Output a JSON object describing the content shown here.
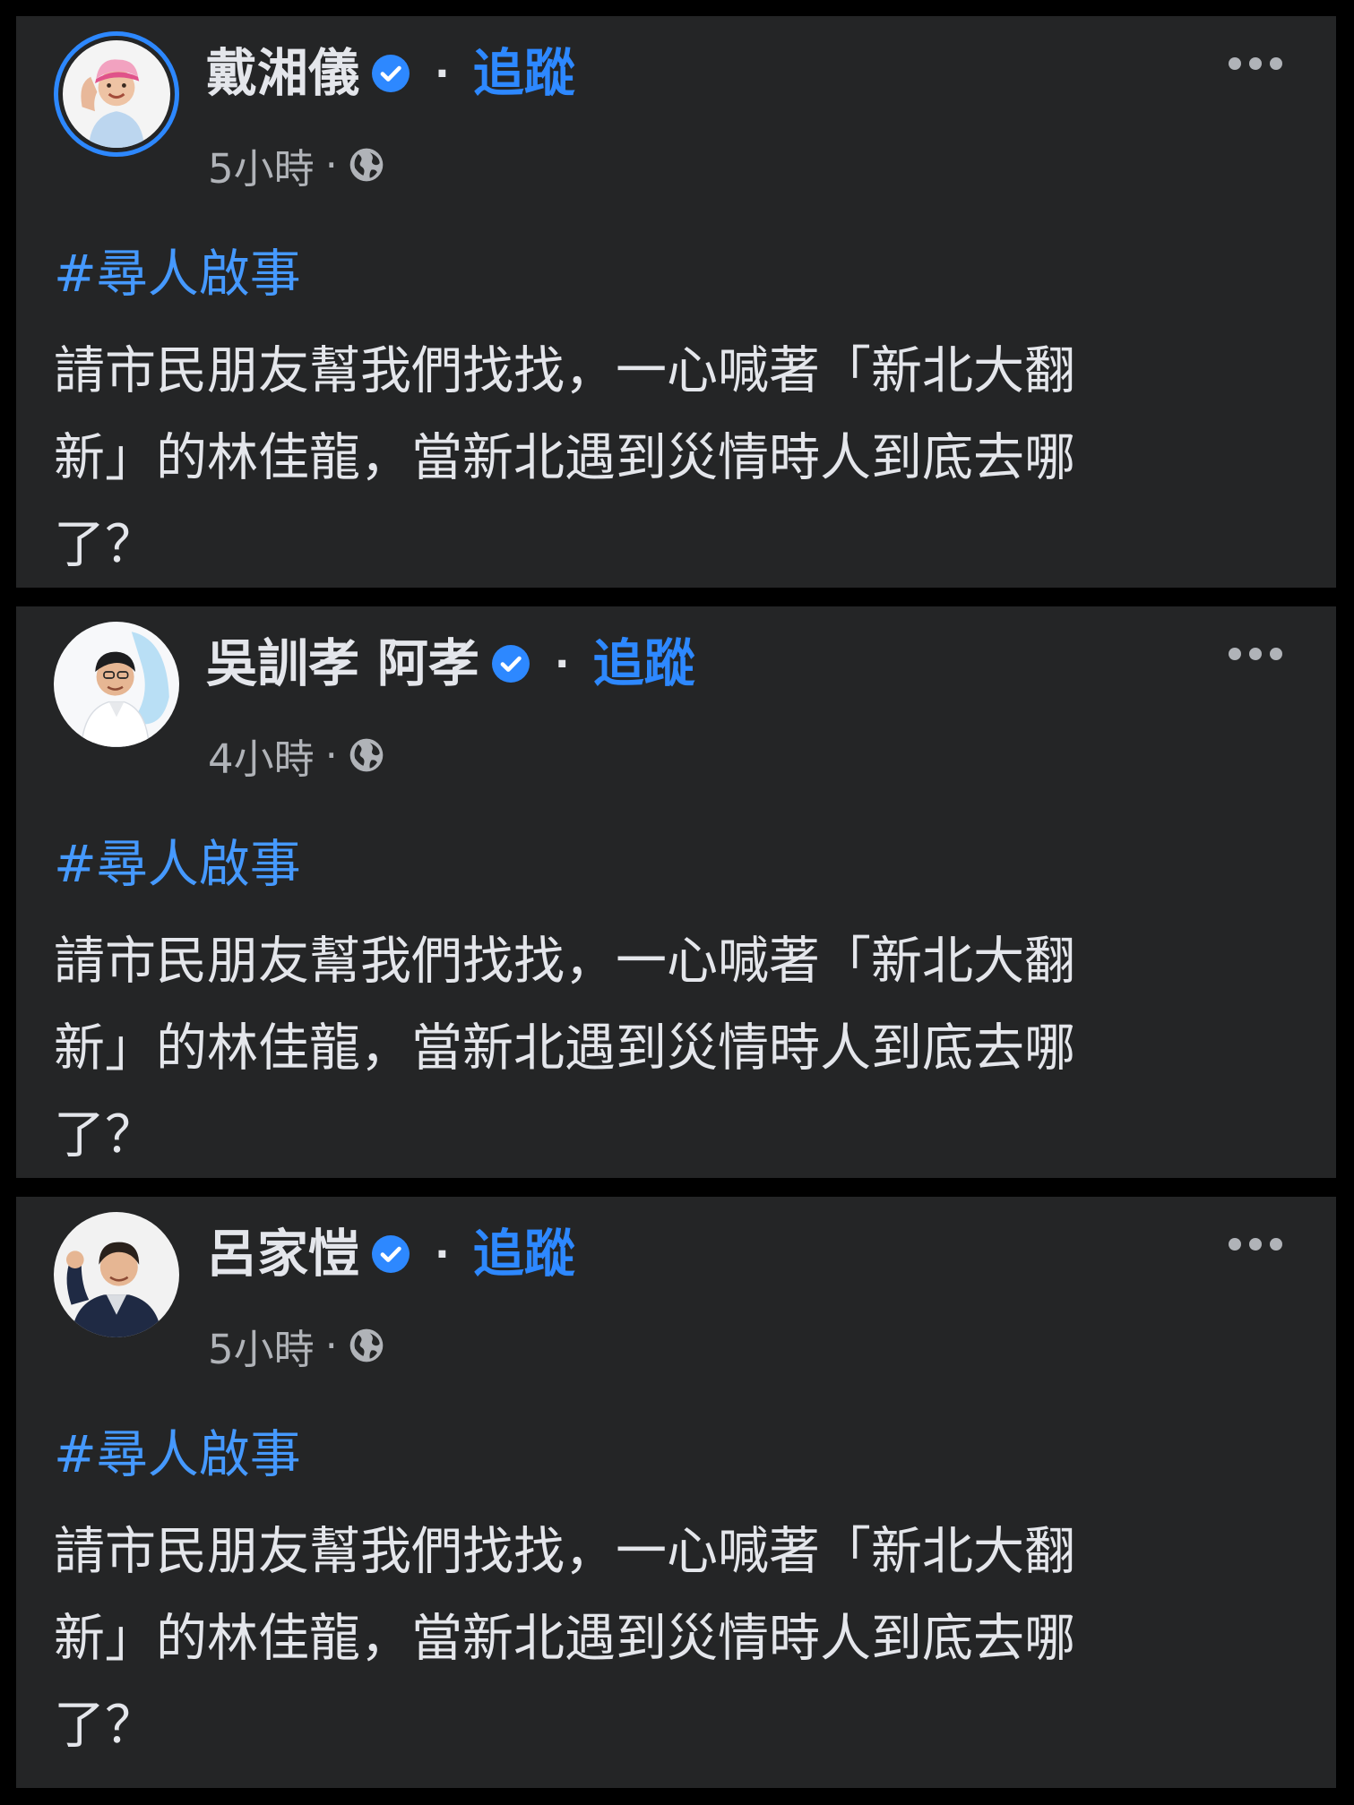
{
  "posts": [
    {
      "author": "戴湘儀",
      "follow_label": "追蹤",
      "separator": "·",
      "timestamp": "5小時",
      "meta_separator": "·",
      "hashtag": "#尋人啟事",
      "body_lines": [
        "請市民朋友幫我們找找，一心喊著「新北大翻",
        "新」的林佳龍，當新北遇到災情時人到底去哪",
        "了？"
      ]
    },
    {
      "author": "吳訓孝 阿孝",
      "follow_label": "追蹤",
      "separator": "·",
      "timestamp": "4小時",
      "meta_separator": "·",
      "hashtag": "#尋人啟事",
      "body_lines": [
        "請市民朋友幫我們找找，一心喊著「新北大翻",
        "新」的林佳龍，當新北遇到災情時人到底去哪",
        "了？"
      ]
    },
    {
      "author": "呂家愷",
      "follow_label": "追蹤",
      "separator": "·",
      "timestamp": "5小時",
      "meta_separator": "·",
      "hashtag": "#尋人啟事",
      "body_lines": [
        "請市民朋友幫我們找找，一心喊著「新北大翻",
        "新」的林佳龍，當新北遇到災情時人到底去哪",
        "了？"
      ]
    }
  ],
  "icons": {
    "verified": "verified-badge-icon",
    "audience": "globe-icon",
    "more": "more-options-icon"
  },
  "colors": {
    "background": "#000000",
    "card": "#242526",
    "text_primary": "#e4e6eb",
    "text_secondary": "#b0b3b8",
    "link_blue": "#2d88ff",
    "hashtag_blue": "#4599ff"
  }
}
